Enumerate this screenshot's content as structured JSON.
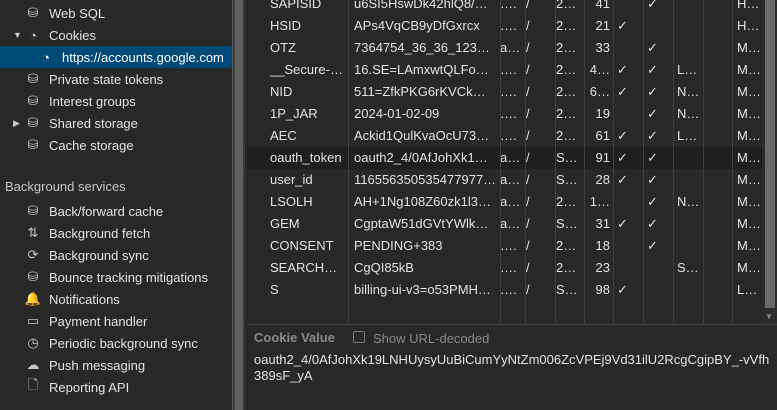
{
  "sidebar": {
    "storage_items": [
      {
        "label": "Web SQL",
        "icon": "database-icon"
      },
      {
        "label": "Cookies",
        "icon": "cookie-icon",
        "expanded": true
      },
      {
        "label": "https://accounts.google.com",
        "icon": "cookie-icon",
        "selected": true
      },
      {
        "label": "Private state tokens",
        "icon": "database-icon"
      },
      {
        "label": "Interest groups",
        "icon": "database-icon"
      },
      {
        "label": "Shared storage",
        "icon": "database-icon",
        "collapsed": true
      },
      {
        "label": "Cache storage",
        "icon": "database-icon"
      }
    ],
    "background_header": "Background services",
    "background_items": [
      {
        "label": "Back/forward cache",
        "icon": "database-icon"
      },
      {
        "label": "Background fetch",
        "icon": "arrows-up-down-icon"
      },
      {
        "label": "Background sync",
        "icon": "sync-icon"
      },
      {
        "label": "Bounce tracking mitigations",
        "icon": "database-icon"
      },
      {
        "label": "Notifications",
        "icon": "bell-icon"
      },
      {
        "label": "Payment handler",
        "icon": "credit-card-icon"
      },
      {
        "label": "Periodic background sync",
        "icon": "clock-icon"
      },
      {
        "label": "Push messaging",
        "icon": "cloud-icon"
      },
      {
        "label": "Reporting API",
        "icon": "document-icon"
      }
    ]
  },
  "cookies": {
    "rows": [
      [
        "SAPISID",
        "u6SI5HswDk42hlQ8/…",
        "….",
        "/",
        "2…",
        "41",
        "",
        "✓",
        "",
        "",
        "H…"
      ],
      [
        "HSID",
        "APs4VqCB9yDfGxrcx",
        "….",
        "/",
        "2…",
        "21",
        "✓",
        "",
        "",
        "",
        "H…"
      ],
      [
        "OTZ",
        "7364754_36_36_123…",
        "a…",
        "/",
        "2…",
        "33",
        "",
        "✓",
        "",
        "",
        "M…"
      ],
      [
        "__Secure-…",
        "16.SE=LAmxwtQLFo…",
        "….",
        "/",
        "2…",
        "4…",
        "✓",
        "✓",
        "L…",
        "",
        "M…"
      ],
      [
        "NID",
        "511=ZfkPKG6rKVCk…",
        "….",
        "/",
        "2…",
        "6…",
        "✓",
        "✓",
        "N…",
        "",
        "M…"
      ],
      [
        "1P_JAR",
        "2024-01-02-09",
        "….",
        "/",
        "2…",
        "19",
        "",
        "✓",
        "N…",
        "",
        "M…"
      ],
      [
        "AEC",
        "Ackid1QulKvaOcU73…",
        "….",
        "/",
        "2…",
        "61",
        "✓",
        "✓",
        "L…",
        "",
        "M…"
      ],
      [
        "oauth_token",
        "oauth2_4/0AfJohXk1…",
        "a…",
        "/",
        "S…",
        "91",
        "✓",
        "✓",
        "",
        "",
        "M…"
      ],
      [
        "user_id",
        "116556350535477977…",
        "a…",
        "/",
        "S…",
        "28",
        "✓",
        "✓",
        "",
        "",
        "M…"
      ],
      [
        "LSOLH",
        "AH+1Ng108Z60zk1l3…",
        "a…",
        "/",
        "2…",
        "1…",
        "",
        "✓",
        "N…",
        "",
        "M…"
      ],
      [
        "GEM",
        "CgptaW51dGVtYWlk…",
        "a…",
        "/",
        "S…",
        "31",
        "✓",
        "✓",
        "",
        "",
        "M…"
      ],
      [
        "CONSENT",
        "PENDING+383",
        "….",
        "/",
        "2…",
        "18",
        "",
        "✓",
        "",
        "",
        "M…"
      ],
      [
        "SEARCH…",
        "CgQI85kB",
        "….",
        "/",
        "2…",
        "23",
        "",
        "",
        "S…",
        "",
        "M…"
      ],
      [
        "S",
        "billing-ui-v3=o53PMH…",
        "….",
        "/",
        "S…",
        "98",
        "✓",
        "",
        "",
        "",
        "L…"
      ]
    ],
    "selected_index": 7
  },
  "value_panel": {
    "title": "Cookie Value",
    "checkbox_label": "Show URL-decoded",
    "checked": false,
    "value": "oauth2_4/0AfJohXk19LNHUysyUuBiCumYyNtZm006ZcVPEj9Vd31ilU2RcgCgipBY_-vVfh389sF_yA"
  }
}
